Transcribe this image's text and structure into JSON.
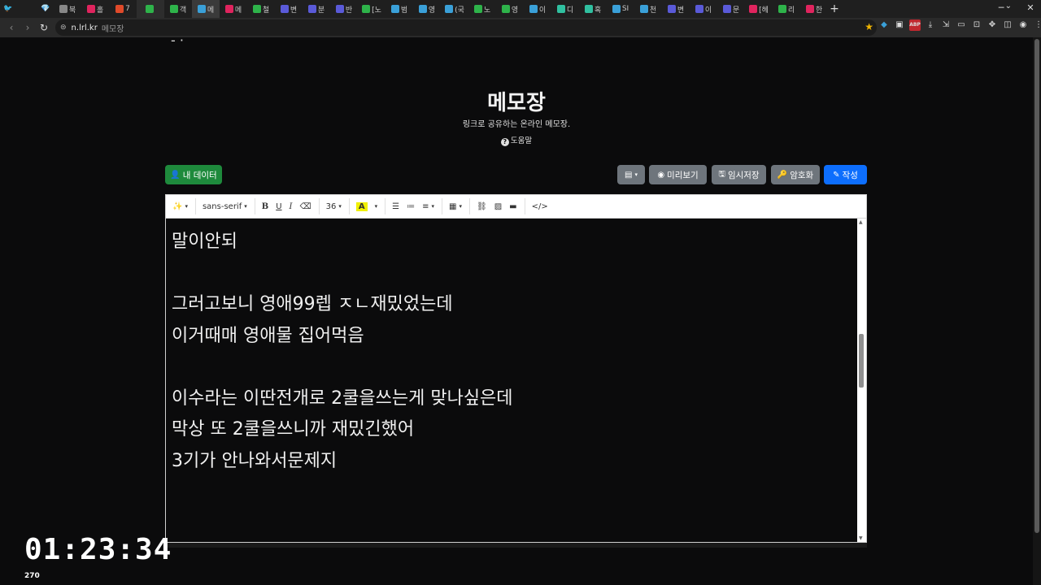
{
  "browser": {
    "tabs": [
      {
        "label": "북",
        "color": "#888888"
      },
      {
        "label": "홀",
        "color": "#e0245e"
      },
      {
        "label": "7",
        "color": "#e04a2a"
      },
      {
        "label": "",
        "color": "#2eb34a"
      },
      {
        "label": "객",
        "color": "#2eb34a"
      },
      {
        "label": "메",
        "color": "#3aa0d8"
      },
      {
        "label": "메",
        "color": "#e0245e"
      },
      {
        "label": "철",
        "color": "#2eb34a"
      },
      {
        "label": "변",
        "color": "#5a5ad8"
      },
      {
        "label": "분",
        "color": "#5a5ad8"
      },
      {
        "label": "반",
        "color": "#5a5ad8"
      },
      {
        "label": "[노",
        "color": "#2eb34a"
      },
      {
        "label": "범",
        "color": "#3aa0d8"
      },
      {
        "label": "영",
        "color": "#3aa0d8"
      },
      {
        "label": "(국",
        "color": "#3aa0d8"
      },
      {
        "label": "노",
        "color": "#2eb34a"
      },
      {
        "label": "영",
        "color": "#2eb34a"
      },
      {
        "label": "이",
        "color": "#3aa0d8"
      },
      {
        "label": "디",
        "color": "#30c0a0"
      },
      {
        "label": "혹",
        "color": "#30c0a0"
      },
      {
        "label": "SI",
        "color": "#3aa0d8"
      },
      {
        "label": "천",
        "color": "#3aa0d8"
      },
      {
        "label": "변",
        "color": "#5a5ad8"
      },
      {
        "label": "이",
        "color": "#5a5ad8"
      },
      {
        "label": "문",
        "color": "#5a5ad8"
      },
      {
        "label": "[헤",
        "color": "#e0245e"
      },
      {
        "label": "리",
        "color": "#2eb34a"
      },
      {
        "label": "한",
        "color": "#e0245e"
      }
    ],
    "new_tab": "+",
    "url_domain": "n.lrl.kr",
    "url_title": "메모장"
  },
  "page": {
    "title": "메모장",
    "subtitle": "링크로 공유하는 온라인 메모장.",
    "help": "도움말",
    "my_data_button": "내 데이터",
    "preview_button": "미리보기",
    "temp_save_button": "임시저장",
    "encrypt_button": "암호화",
    "write_button": "작성"
  },
  "editor_toolbar": {
    "font_family": "sans-serif",
    "font_size": "36",
    "bold": "B",
    "underline": "U",
    "italic": "I",
    "highlight": "A",
    "code": "</>"
  },
  "editor_lines": [
    "말이안되",
    "",
    "그러고보니 영애99렙 ㅈㄴ재밌었는데",
    "이거때매 영애물 집어먹음",
    "",
    "이수라는 이딴전개로 2쿨을쓰는게 맞나싶은데",
    "막상 또 2쿨을쓰니까 재밌긴했어",
    "3기가 안나와서문제지",
    ""
  ],
  "overlay": {
    "timer": "01:23:34",
    "counter": "270"
  }
}
